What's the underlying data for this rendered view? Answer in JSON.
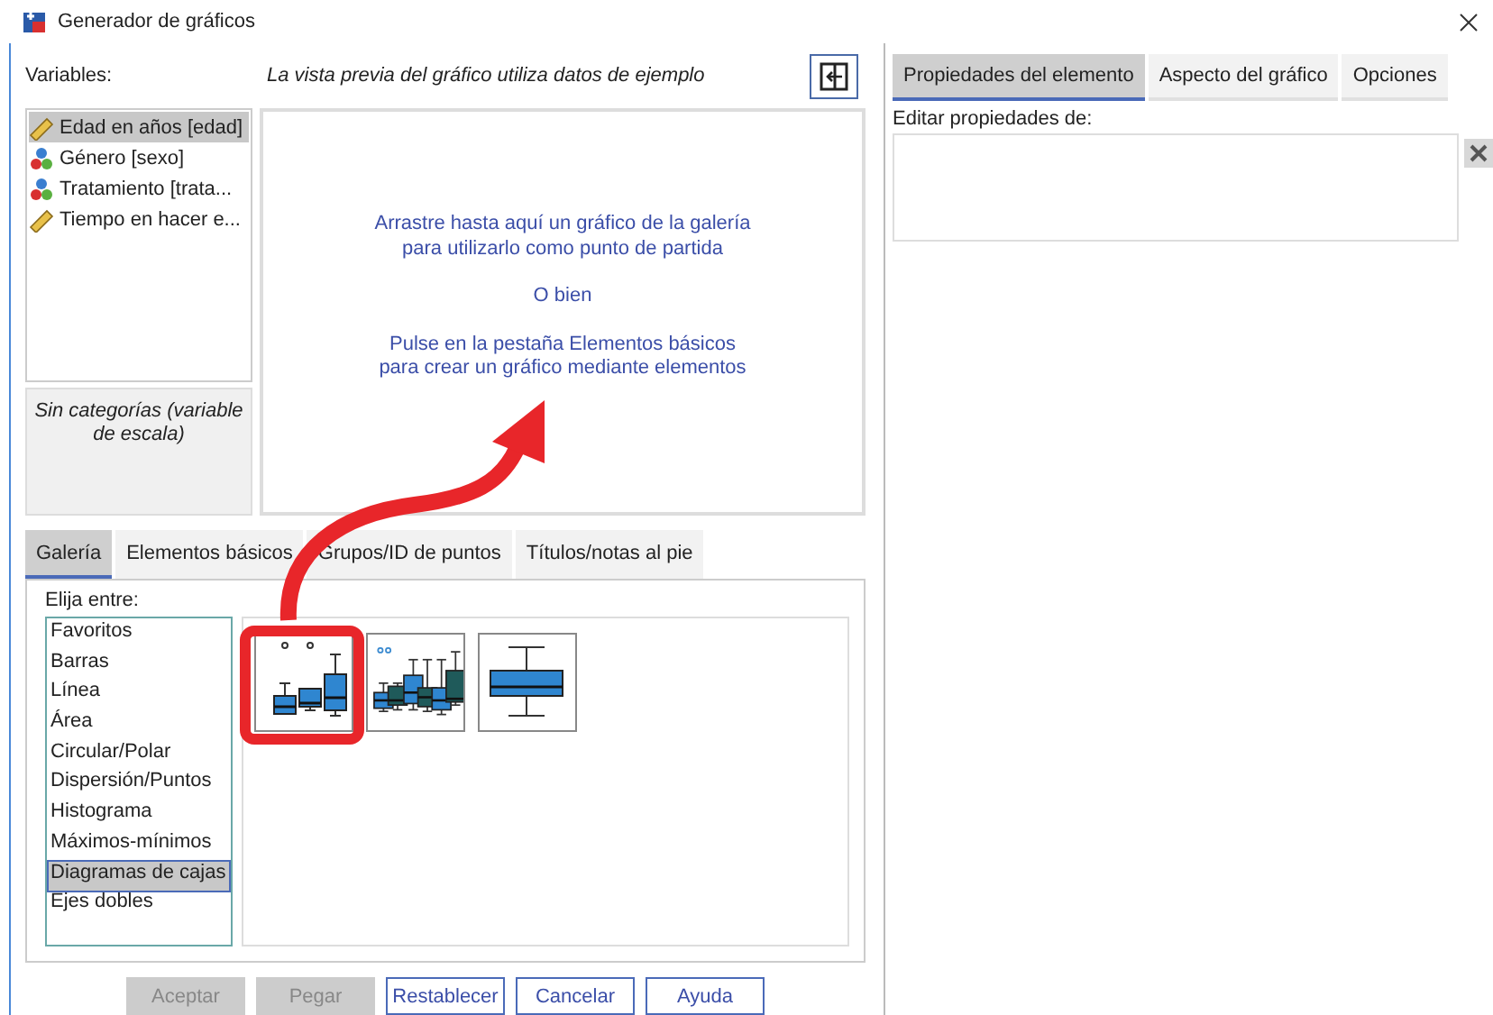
{
  "window": {
    "title": "Generador de gráficos"
  },
  "variables": {
    "label": "Variables:",
    "items": [
      {
        "name": "Edad en años [edad]",
        "kind": "scale",
        "selected": true
      },
      {
        "name": "Género [sexo]",
        "kind": "nominal",
        "selected": false
      },
      {
        "name": "Tratamiento [trata...",
        "kind": "nominal",
        "selected": false
      },
      {
        "name": "Tiempo en hacer e...",
        "kind": "scale",
        "selected": false
      }
    ],
    "category_note": "Sin categorías (variable de escala)"
  },
  "preview": {
    "notice": "La vista previa del gráfico utiliza datos de ejemplo",
    "paragraphs": [
      [
        "Arrastre hasta aquí un gráfico de la galería",
        "para utilizarlo como punto de partida"
      ],
      [
        "O bien"
      ],
      [
        "Pulse en la pestaña Elementos básicos",
        "para crear un gráfico mediante elementos"
      ]
    ]
  },
  "tabs": [
    {
      "label": "Galería",
      "selected": true
    },
    {
      "label": "Elementos básicos",
      "selected": false
    },
    {
      "label": "Grupos/ID de puntos",
      "selected": false
    },
    {
      "label": "Títulos/notas al pie",
      "selected": false
    }
  ],
  "gallery": {
    "label": "Elija entre:",
    "categories": [
      {
        "label": "Favoritos",
        "selected": false
      },
      {
        "label": "Barras",
        "selected": false
      },
      {
        "label": "Línea",
        "selected": false
      },
      {
        "label": "Área",
        "selected": false
      },
      {
        "label": "Circular/Polar",
        "selected": false
      },
      {
        "label": "Dispersión/Puntos",
        "selected": false
      },
      {
        "label": "Histograma",
        "selected": false
      },
      {
        "label": "Máximos-mínimos",
        "selected": false
      },
      {
        "label": "Diagramas de cajas",
        "selected": true
      },
      {
        "label": "Ejes dobles",
        "selected": false
      }
    ]
  },
  "buttons": [
    {
      "label": "Aceptar",
      "disabled": true
    },
    {
      "label": "Pegar",
      "disabled": true
    },
    {
      "label": "Restablecer",
      "disabled": false
    },
    {
      "label": "Cancelar",
      "disabled": false
    },
    {
      "label": "Ayuda",
      "disabled": false
    }
  ],
  "properties": {
    "tabs": [
      {
        "label": "Propiedades del elemento",
        "selected": true
      },
      {
        "label": "Aspecto del gráfico",
        "selected": false
      },
      {
        "label": "Opciones",
        "selected": false
      }
    ],
    "edit_label": "Editar propiedades de:"
  }
}
